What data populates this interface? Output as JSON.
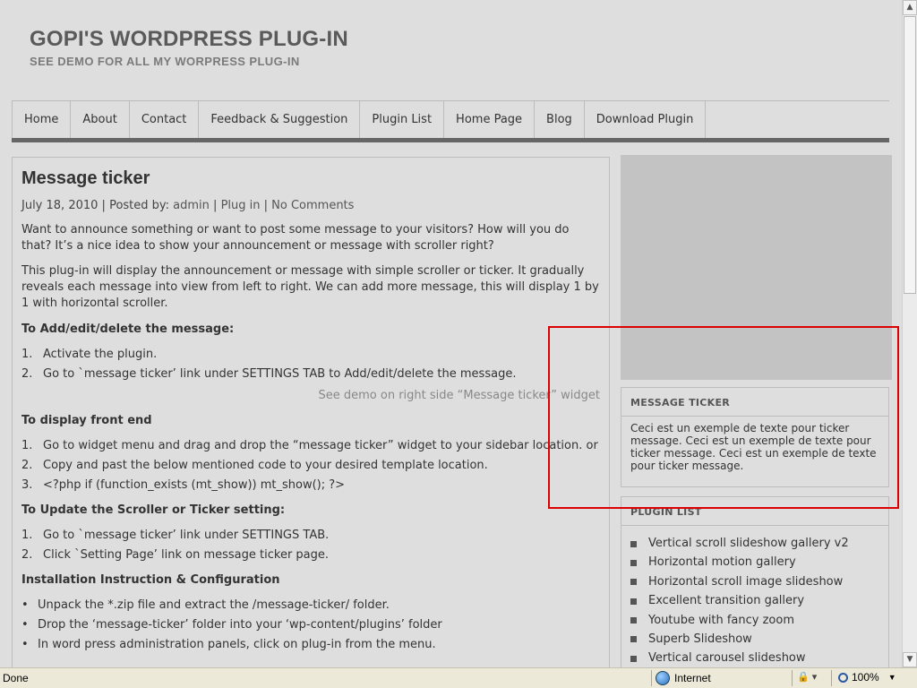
{
  "site": {
    "title": "GOPI'S WORDPRESS PLUG-IN",
    "subtitle": "SEE DEMO FOR ALL MY WORPRESS PLUG-IN"
  },
  "nav": {
    "items": [
      "Home",
      "About",
      "Contact",
      "Feedback & Suggestion",
      "Plugin List",
      "Home Page",
      "Blog",
      "Download Plugin"
    ]
  },
  "post": {
    "title": "Message ticker",
    "date": "July 18, 2010",
    "posted_by": "Posted by:",
    "author": "admin",
    "category": "Plug in",
    "comments": "No Comments",
    "para1": "Want to announce something or want to post some message to your visitors? How will you do that? It’s a nice idea to show your announcement or message with scroller right?",
    "para2": "This plug-in will display the announcement or message with simple scroller or ticker. It gradually reveals each message into view from left to right. We can add more message, this will display 1 by 1 with horizontal scroller.",
    "h_add": "To Add/edit/delete the message:",
    "add_steps": [
      "Activate the plugin.",
      "Go to `message ticker’ link under SETTINGS TAB to Add/edit/delete the message."
    ],
    "demo_note": "See demo on right side “Message ticker” widget",
    "h_display": "To display front end",
    "display_steps": [
      "Go to widget menu and drag and drop the “message ticker” widget to your sidebar location. or",
      "Copy and past the below mentioned code to your desired template location.",
      "<?php if (function_exists (mt_show)) mt_show(); ?>"
    ],
    "h_update": "To Update the Scroller or Ticker setting:",
    "update_steps": [
      "Go to `message ticker’ link under SETTINGS TAB.",
      "Click `Setting Page’ link on message ticker page."
    ],
    "h_install": "Installation Instruction & Configuration",
    "install_steps": [
      "Unpack the *.zip file and extract the /message-ticker/ folder.",
      "Drop the ‘message-ticker’ folder into your ‘wp-content/plugins’ folder",
      "In word press administration panels, click on plug-in from the menu."
    ]
  },
  "sidebar": {
    "ticker_title": "MESSAGE TICKER",
    "ticker_text": "Ceci est un exemple de texte pour ticker message. Ceci est un exemple de texte pour ticker message. Ceci est un exemple de texte pour ticker message.",
    "plugin_list_title": "PLUGIN LIST",
    "plugin_list": [
      "Vertical scroll slideshow gallery v2",
      "Horizontal motion gallery",
      "Horizontal scroll image slideshow",
      "Excellent transition gallery",
      "Youtube with fancy zoom",
      "Superb Slideshow",
      "Vertical carousel slideshow"
    ]
  },
  "statusbar": {
    "status": "Done",
    "zone": "Internet",
    "zoom": "100%"
  },
  "colors": {
    "annotation_box": "#dd0000",
    "page_bg": "#dedede"
  }
}
